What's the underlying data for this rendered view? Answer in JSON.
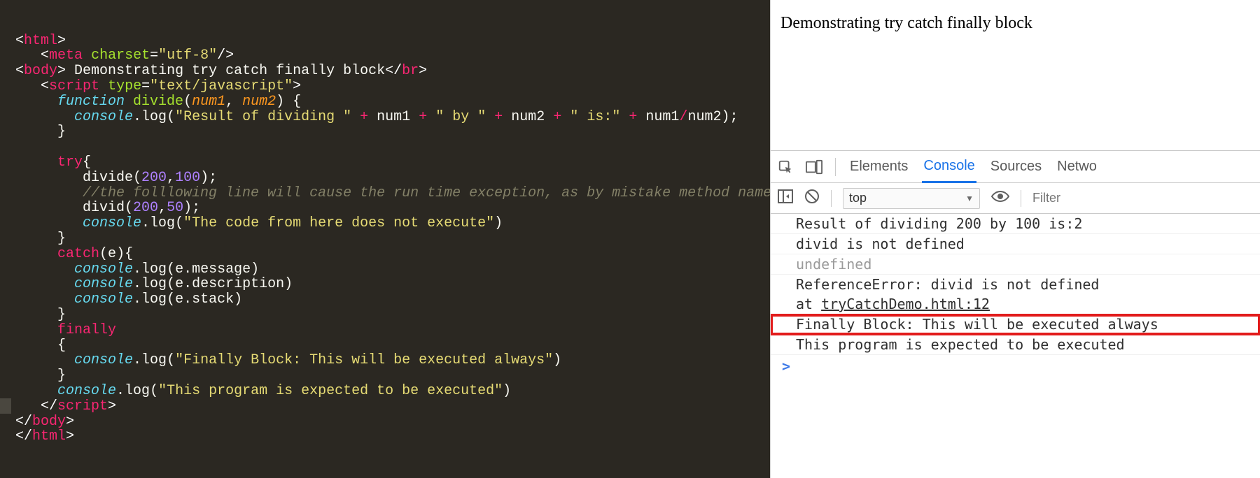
{
  "code": {
    "tags": {
      "html": "html",
      "meta": "meta",
      "body": "body",
      "br": "br",
      "script": "script"
    },
    "attrs": {
      "charset": "charset",
      "type": "type",
      "charset_val": "utf-8",
      "type_val": "text/javascript"
    },
    "body_text": " Demonstrating try catch finally block",
    "kw": {
      "function": "function",
      "try": "try",
      "catch": "catch",
      "finally": "finally"
    },
    "fn": {
      "divide": "divide",
      "log": "log"
    },
    "ident": {
      "console": "console",
      "divid": "divid",
      "e": "e",
      "message": "message",
      "description": "description",
      "stack": "stack"
    },
    "params": {
      "num1": "num1",
      "num2": "num2"
    },
    "nums": {
      "n200": "200",
      "n100": "100",
      "n50": "50"
    },
    "strings": {
      "res1": "\"Result of dividing \"",
      "res2": "\" by \"",
      "res3": "\" is:\"",
      "noexec": "\"The code from here does not execute\"",
      "fin": "\"Finally Block: This will be executed always\"",
      "prog": "\"This program is expected to be executed\""
    },
    "comment": "//the folllowing line will cause the run time exception, as by mistake method name is wrong"
  },
  "page": {
    "heading": "Demonstrating try catch finally block"
  },
  "devtools": {
    "tabs": {
      "elements": "Elements",
      "console": "Console",
      "sources": "Sources",
      "network": "Netwo"
    },
    "toolbar": {
      "context": "top",
      "filter_placeholder": "Filter"
    },
    "log": [
      "Result of dividing 200 by 100 is:2",
      "divid is not defined",
      "undefined",
      "ReferenceError: divid is not defined",
      "tryCatchDemo.html:12",
      "Finally Block: This will be executed always",
      "This program is expected to be executed"
    ],
    "log_at": "    at ",
    "prompt": ">"
  }
}
